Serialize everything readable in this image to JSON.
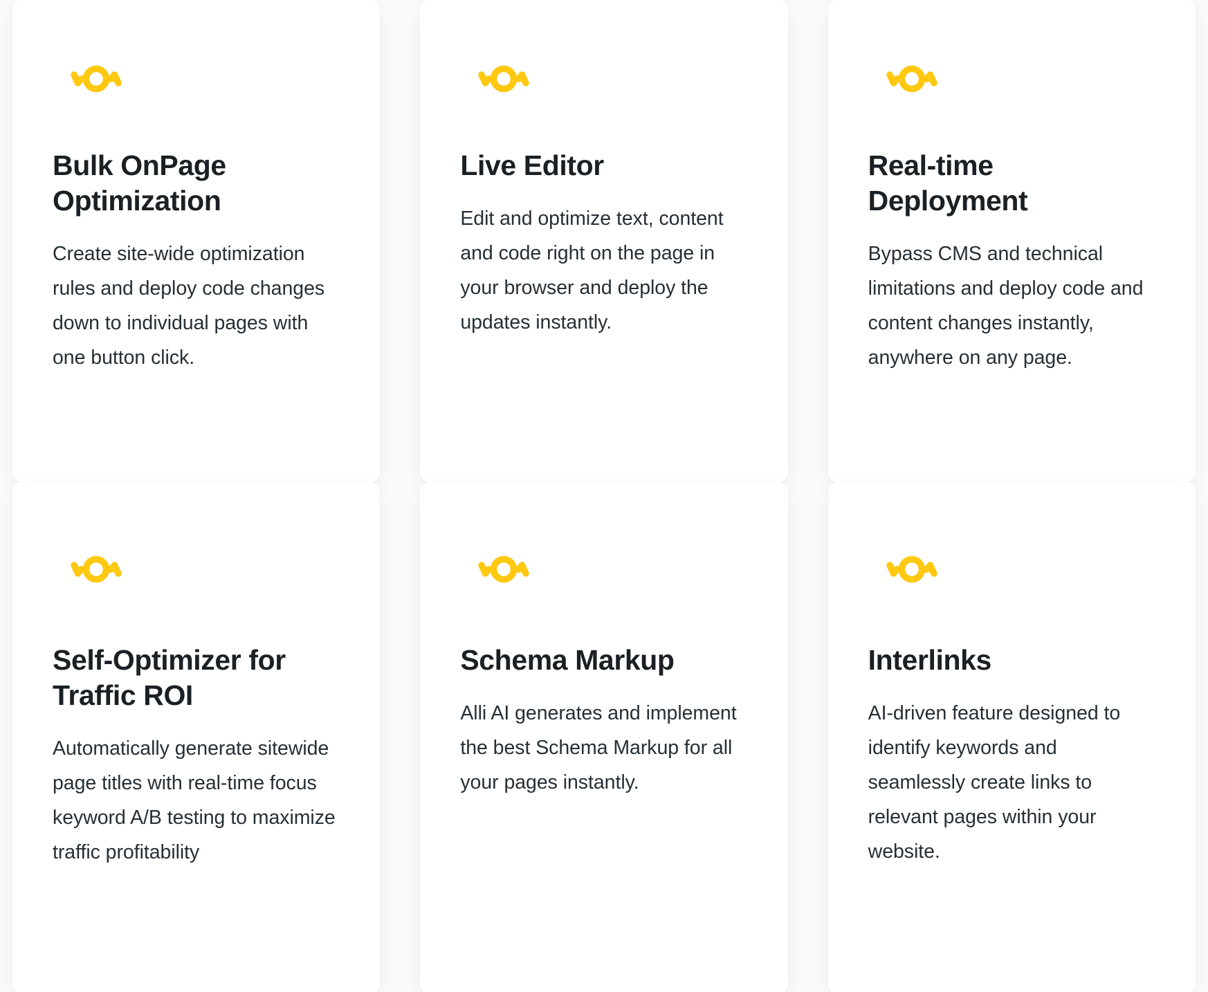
{
  "theme": {
    "page_background": "#fafafa",
    "card_background": "#ffffff",
    "heading_color": "#1a2024",
    "body_color": "#262f36",
    "icon_blue_dark": "#1a7ae8",
    "icon_blue_light": "#74abf2",
    "icon_yellow": "#ffc811"
  },
  "features": [
    {
      "icon": "alli-ai-hexagon-logo-icon",
      "title": "Bulk OnPage Optimization",
      "description": "Create site-wide optimization rules and deploy code changes down to individual pages with one button click."
    },
    {
      "icon": "alli-ai-hexagon-logo-icon",
      "title": "Live Editor",
      "description": "Edit and optimize text, content and code right on the page in your browser and deploy the updates instantly."
    },
    {
      "icon": "alli-ai-hexagon-logo-icon",
      "title": "Real-time Deployment",
      "description": "Bypass CMS and technical limitations and deploy code and content changes instantly, anywhere on any page."
    },
    {
      "icon": "alli-ai-hexagon-logo-icon",
      "title": "Self-Optimizer for Traffic ROI",
      "description": "Automatically generate sitewide page titles with real-time focus keyword A/B testing to maximize traffic profitability"
    },
    {
      "icon": "alli-ai-hexagon-logo-icon",
      "title": "Schema Markup",
      "description": "Alli AI generates and implement the best Schema Markup for all your pages instantly."
    },
    {
      "icon": "alli-ai-hexagon-logo-icon",
      "title": "Interlinks",
      "description": "AI-driven feature designed to identify keywords and seamlessly create links to relevant pages within your website."
    }
  ]
}
